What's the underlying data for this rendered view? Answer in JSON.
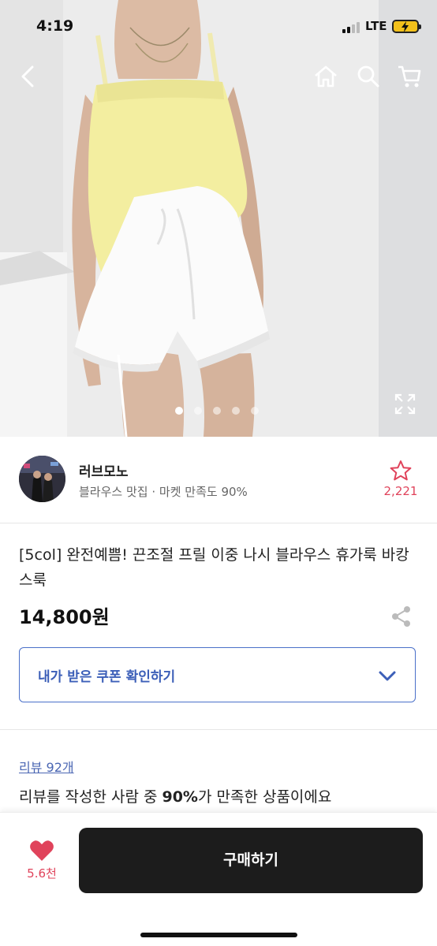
{
  "status_bar": {
    "time": "4:19",
    "network": "LTE"
  },
  "header": {
    "back_icon": "chevron-left-icon",
    "home_icon": "home-icon",
    "search_icon": "search-icon",
    "cart_icon": "cart-icon"
  },
  "gallery": {
    "image_count": 5,
    "active_index": 0,
    "expand_icon": "expand-icon"
  },
  "seller": {
    "name": "러브모노",
    "tag": "블라우스 맛집",
    "separator": "·",
    "satisfaction": "마켓 만족도 90%",
    "bookmark_count": "2,221"
  },
  "product": {
    "title": "[5col] 완전예쁨! 끈조절 프릴 이중 나시 블라우스 휴가룩 바캉스룩",
    "price": "14,800원"
  },
  "coupon": {
    "label": "내가 받은 쿠폰 확인하기"
  },
  "review": {
    "link": "리뷰 92개",
    "summary_prefix": "리뷰를 작성한 사람 중 ",
    "summary_highlight": "90%",
    "summary_suffix": "가 만족한 상품이에요"
  },
  "bottom_bar": {
    "like_count": "5.6천",
    "buy_label": "구매하기"
  },
  "colors": {
    "accent_red": "#e0435b",
    "coupon_blue": "#4a70c9",
    "buy_button": "#1c1c1c"
  }
}
